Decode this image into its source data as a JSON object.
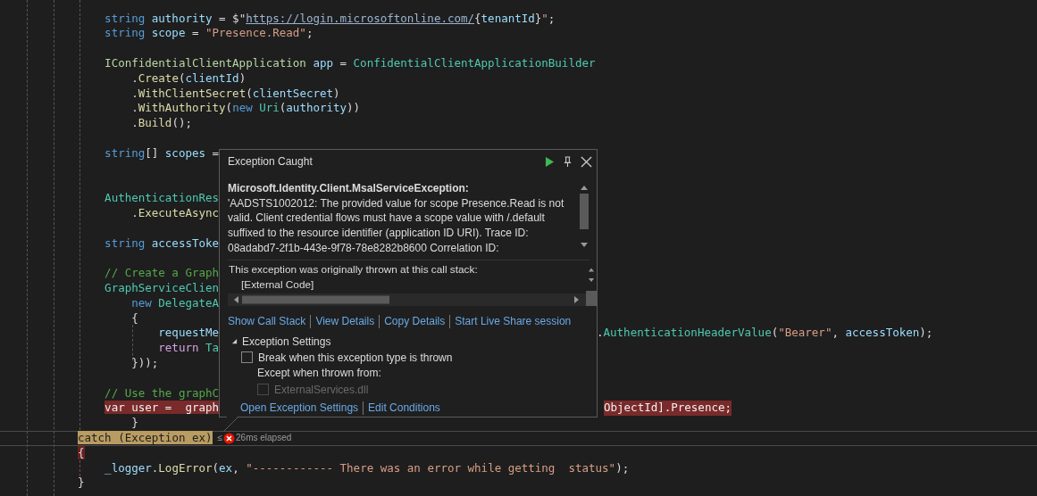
{
  "code": {
    "lines": [
      {
        "kind": "code",
        "tokens": [
          {
            "kind": "kw",
            "text": "    string"
          },
          {
            "kind": "var",
            "text": " authority"
          },
          {
            "kind": "plain",
            "text": " = $\""
          },
          {
            "kind": "url",
            "text": "https://login.microsoftonline.com/"
          },
          {
            "kind": "plain",
            "text": "{"
          },
          {
            "kind": "var",
            "text": "tenantId"
          },
          {
            "kind": "plain",
            "text": "}"
          },
          {
            "kind": "str",
            "text": "\""
          },
          {
            "kind": "plain",
            "text": ";"
          }
        ]
      },
      {
        "kind": "code",
        "tokens": [
          {
            "kind": "kw",
            "text": "    string"
          },
          {
            "kind": "var",
            "text": " scope"
          },
          {
            "kind": "plain",
            "text": " = "
          },
          {
            "kind": "str",
            "text": "\"Presence.Read\""
          },
          {
            "kind": "plain",
            "text": ";"
          }
        ]
      },
      {
        "kind": "blank"
      },
      {
        "kind": "code",
        "tokens": [
          {
            "kind": "iface",
            "text": "    IConfidentialClientApplication"
          },
          {
            "kind": "var",
            "text": " app"
          },
          {
            "kind": "plain",
            "text": " = "
          },
          {
            "kind": "type",
            "text": "ConfidentialClientApplicationBuilder"
          }
        ]
      },
      {
        "kind": "code",
        "tokens": [
          {
            "kind": "plain",
            "text": "        ."
          },
          {
            "kind": "method",
            "text": "Create"
          },
          {
            "kind": "plain",
            "text": "("
          },
          {
            "kind": "var",
            "text": "clientId"
          },
          {
            "kind": "plain",
            "text": ")"
          }
        ]
      },
      {
        "kind": "code",
        "tokens": [
          {
            "kind": "plain",
            "text": "        ."
          },
          {
            "kind": "method",
            "text": "WithClientSecret"
          },
          {
            "kind": "plain",
            "text": "("
          },
          {
            "kind": "var",
            "text": "clientSecret"
          },
          {
            "kind": "plain",
            "text": ")"
          }
        ]
      },
      {
        "kind": "code",
        "tokens": [
          {
            "kind": "plain",
            "text": "        ."
          },
          {
            "kind": "method",
            "text": "WithAuthority"
          },
          {
            "kind": "plain",
            "text": "("
          },
          {
            "kind": "kw",
            "text": "new"
          },
          {
            "kind": "type",
            "text": " Uri"
          },
          {
            "kind": "plain",
            "text": "("
          },
          {
            "kind": "var",
            "text": "authority"
          },
          {
            "kind": "plain",
            "text": "))"
          }
        ]
      },
      {
        "kind": "code",
        "tokens": [
          {
            "kind": "plain",
            "text": "        ."
          },
          {
            "kind": "method",
            "text": "Build"
          },
          {
            "kind": "plain",
            "text": "();"
          }
        ]
      },
      {
        "kind": "blank"
      },
      {
        "kind": "code",
        "tokens": [
          {
            "kind": "kw",
            "text": "    string"
          },
          {
            "kind": "plain",
            "text": "[] "
          },
          {
            "kind": "var",
            "text": "scopes"
          },
          {
            "kind": "plain",
            "text": " ="
          }
        ]
      },
      {
        "kind": "blank"
      },
      {
        "kind": "blank"
      },
      {
        "kind": "code",
        "tokens": [
          {
            "kind": "type",
            "text": "    AuthenticationRes"
          }
        ]
      },
      {
        "kind": "code",
        "tokens": [
          {
            "kind": "plain",
            "text": "        ."
          },
          {
            "kind": "method",
            "text": "ExecuteAsync"
          }
        ]
      },
      {
        "kind": "blank"
      },
      {
        "kind": "code",
        "tokens": [
          {
            "kind": "kw",
            "text": "    string"
          },
          {
            "kind": "var",
            "text": " accessToke"
          }
        ]
      },
      {
        "kind": "blank"
      },
      {
        "kind": "code",
        "tokens": [
          {
            "kind": "comment",
            "text": "    // Create a Graph"
          }
        ]
      },
      {
        "kind": "code",
        "tokens": [
          {
            "kind": "type",
            "text": "    GraphServiceClien"
          }
        ]
      },
      {
        "kind": "code",
        "tokens": [
          {
            "kind": "kw",
            "text": "        new"
          },
          {
            "kind": "type",
            "text": " DelegateA"
          }
        ]
      },
      {
        "kind": "code",
        "tokens": [
          {
            "kind": "plain",
            "text": "        {"
          }
        ]
      },
      {
        "kind": "code",
        "tokens": [
          {
            "kind": "var",
            "text": "            requestMe"
          }
        ],
        "right": [
          {
            "kind": "plain",
            "text": "."
          },
          {
            "kind": "type",
            "text": "AuthenticationHeaderValue"
          },
          {
            "kind": "plain",
            "text": "("
          },
          {
            "kind": "str",
            "text": "\"Bearer\""
          },
          {
            "kind": "plain",
            "text": ", "
          },
          {
            "kind": "var",
            "text": "accessToken"
          },
          {
            "kind": "plain",
            "text": ");"
          }
        ]
      },
      {
        "kind": "code",
        "tokens": [
          {
            "kind": "ctrl",
            "text": "            return"
          },
          {
            "kind": "type",
            "text": " Ta"
          }
        ]
      },
      {
        "kind": "code",
        "tokens": [
          {
            "kind": "plain",
            "text": "        }));"
          }
        ]
      },
      {
        "kind": "blank"
      },
      {
        "kind": "code",
        "tokens": [
          {
            "kind": "comment",
            "text": "    // Use the graphC"
          }
        ]
      },
      {
        "kind": "code",
        "error": true,
        "tokens": [
          {
            "kind": "kw",
            "text": "    var"
          },
          {
            "kind": "var",
            "text": " user"
          },
          {
            "kind": "plain",
            "text": " =  "
          },
          {
            "kind": "var",
            "text": "graph"
          }
        ],
        "right": [
          {
            "kind": "plain",
            "text": "ObjectId].Presence;"
          }
        ]
      },
      {
        "kind": "code",
        "tokens": [
          {
            "kind": "plain",
            "text": "        }"
          }
        ]
      },
      {
        "kind": "code",
        "current": true,
        "tokens": [
          {
            "kind": "kw",
            "text": "catch"
          },
          {
            "kind": "plain",
            "text": " ("
          },
          {
            "kind": "type",
            "text": "Exception"
          },
          {
            "kind": "var",
            "text": " ex"
          },
          {
            "kind": "plain",
            "text": ")"
          }
        ],
        "hint": {
          "prefix": "≤",
          "failed": true,
          "text": "26ms elapsed"
        }
      },
      {
        "kind": "code",
        "brace_match": true,
        "tokens": [
          {
            "kind": "plain",
            "text": "{"
          }
        ]
      },
      {
        "kind": "code",
        "tokens": [
          {
            "kind": "var",
            "text": "    _logger"
          },
          {
            "kind": "plain",
            "text": "."
          },
          {
            "kind": "method",
            "text": "LogError"
          },
          {
            "kind": "plain",
            "text": "("
          },
          {
            "kind": "var",
            "text": "ex"
          },
          {
            "kind": "plain",
            "text": ", "
          },
          {
            "kind": "str",
            "text": "\"------------ There was an error while getting  status\""
          },
          {
            "kind": "plain",
            "text": ");"
          }
        ]
      },
      {
        "kind": "code",
        "tokens": [
          {
            "kind": "plain",
            "text": "}"
          }
        ]
      }
    ]
  },
  "exception_popup": {
    "title": "Exception Caught",
    "exception_type": "Microsoft.Identity.Client.MsalServiceException:",
    "message": "'AADSTS1002012: The provided value for scope Presence.Read is not valid. Client credential flows must have a scope value with /.default suffixed to the resource identifier (application ID URI). Trace ID: 08adabd7-2f1b-443e-9f78-78e8282b8600 Correlation ID:",
    "call_stack": {
      "heading": "This exception was originally thrown at this call stack:",
      "frames": [
        "[External Code]"
      ]
    },
    "actions": [
      "Show Call Stack",
      "View Details",
      "Copy Details",
      "Start Live Share session"
    ],
    "settings": {
      "title": "Exception Settings",
      "expanded": true,
      "break_option": {
        "label": "Break when this exception type is thrown",
        "checked": false,
        "disabled": false
      },
      "except_label": "Except when thrown from:",
      "modules": [
        {
          "label": "ExternalServices.dll",
          "checked": false,
          "disabled": true
        }
      ],
      "links": [
        "Open Exception Settings",
        "Edit Conditions"
      ]
    }
  }
}
